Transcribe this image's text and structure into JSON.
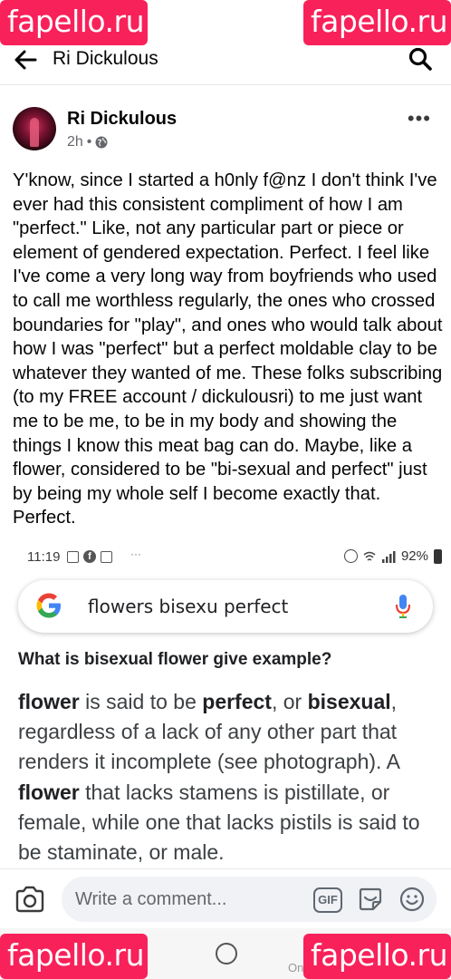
{
  "watermarks": {
    "top_left": "fapello.ru",
    "top_right": "fapello.ru",
    "bottom_left": "fapello.ru",
    "bottom_right": "fapello.ru"
  },
  "topbar": {
    "title": "Ri Dickulous"
  },
  "post": {
    "author": "Ri Dickulous",
    "time": "2h",
    "separator": "•",
    "text": "Y'know, since I started a h0nly f@nz I don't think I've ever had this consistent compliment of how I am \"perfect.\" Like, not any particular part or piece or element of gendered expectation. Perfect. I feel like I've come a very long way from boyfriends who used to call me worthless regularly, the ones who crossed boundaries for \"play\", and ones who would talk about how I was \"perfect\" but a perfect moldable clay to be whatever they wanted of me. These folks subscribing (to my FREE account / dickulousri) to me just want me to be me, to be in my body and showing the things I know this meat bag can do. Maybe, like a flower, considered to be \"bi-sexual and perfect\" just by being my whole self I become exactly that. Perfect."
  },
  "screenshot": {
    "status_time": "11:19",
    "status_dots": "···",
    "battery": "92%",
    "search_query": "flowers bisexu perfect",
    "question": "What is bisexual flower give example?",
    "answer": {
      "w1": "flower",
      "t1": " is said to be ",
      "w2": "perfect",
      "t2": ", or ",
      "w3": "bisexual",
      "t3": ", regardless of a lack of any other part that renders it incomplete (see photograph). A ",
      "w4": "flower",
      "t4": " that lacks stamens is pistillate, or female, while one that lacks pistils is said to be staminate, or male."
    }
  },
  "comment": {
    "placeholder": "Write a comment...",
    "gif_label": "GIF"
  },
  "navbar": {
    "caption": "Onl"
  },
  "colors": {
    "watermark": "#f8215a",
    "google_blue": "#4285f4",
    "google_red": "#ea4335",
    "google_yellow": "#fbbc05",
    "google_green": "#34a853"
  }
}
